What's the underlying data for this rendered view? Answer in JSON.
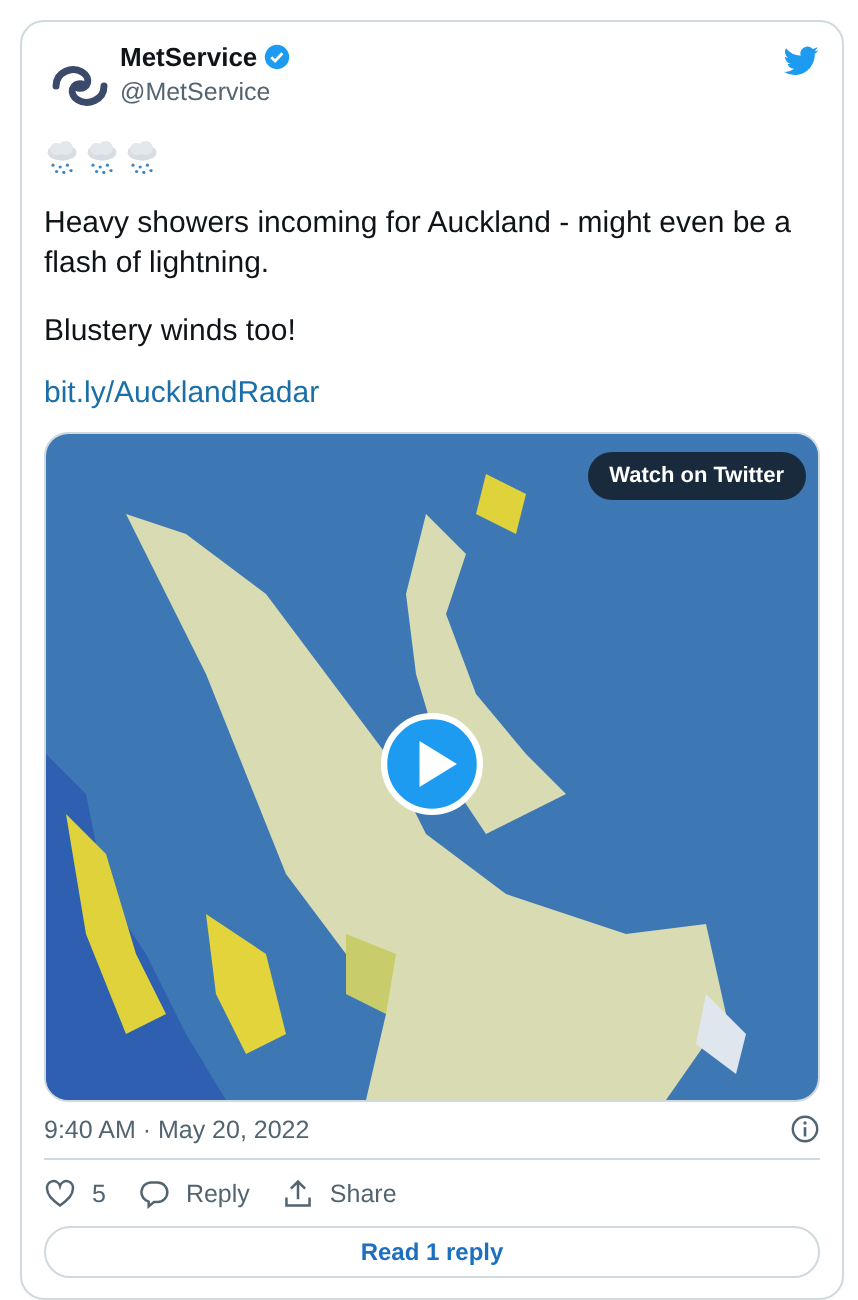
{
  "author": {
    "name": "MetService",
    "handle": "@MetService",
    "verified": true
  },
  "emojis": [
    {
      "kind": "rain_cloud"
    },
    {
      "kind": "rain_cloud"
    },
    {
      "kind": "rain_cloud"
    }
  ],
  "paragraphs": [
    "Heavy showers incoming for Auckland - might even be a flash of lightning.",
    "Blustery winds too!"
  ],
  "link": "bit.ly/AucklandRadar",
  "media": {
    "kind": "picture",
    "watch_label": "Watch on Twitter"
  },
  "timestamp": "9:40 AM · May 20, 2022",
  "actions": [
    {
      "kind": "like",
      "label": "5"
    },
    {
      "kind": "reply",
      "label": "Reply"
    },
    {
      "kind": "share",
      "label": "Share"
    }
  ],
  "read_replies": "Read 1 reply"
}
